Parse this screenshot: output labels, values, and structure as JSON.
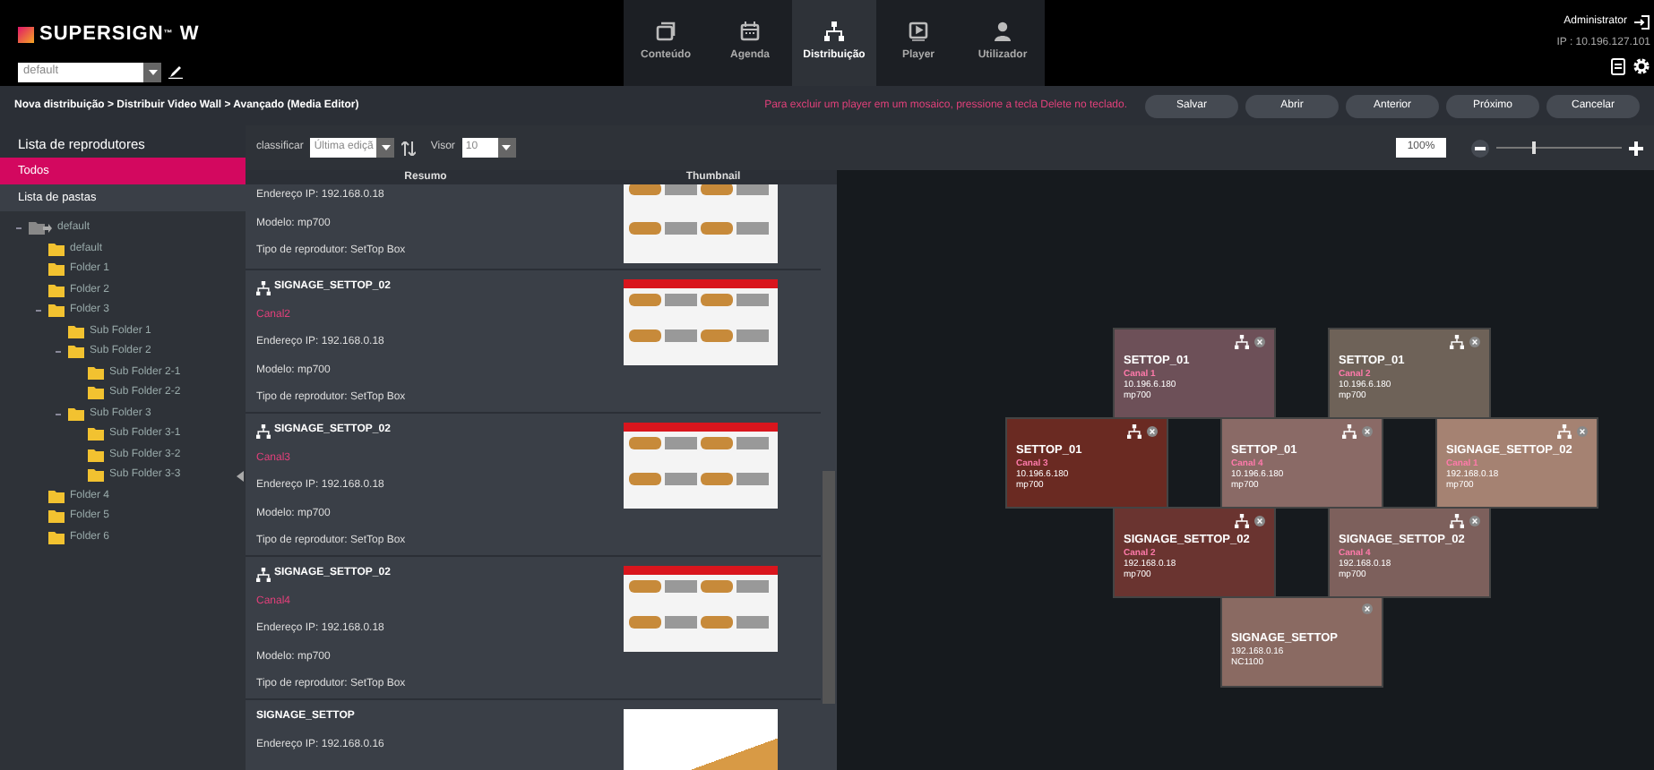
{
  "header": {
    "logo": "SUPERSIGN$^{™}$ W",
    "group_select": {
      "value": "default"
    },
    "tabs": [
      {
        "label": "Conteúdo",
        "kind": "content",
        "selected": false
      },
      {
        "label": "Agenda",
        "kind": "schedule",
        "selected": false
      },
      {
        "label": "Distribuição",
        "kind": "distribution",
        "selected": true
      },
      {
        "label": "Player",
        "kind": "player",
        "selected": false
      },
      {
        "label": "Utilizador",
        "kind": "user",
        "selected": false
      }
    ],
    "user": "Administrator",
    "ip": "IP : 10.196.127.101"
  },
  "breadcrumb": "Nova distribuição > Distribuir Video Wall > Avançado (Media Editor)",
  "hint": "Para excluir um player em um mosaico, pressione a tecla Delete no teclado.",
  "buttons": [
    "Salvar",
    "Abrir",
    "Anterior",
    "Próximo",
    "Cancelar"
  ],
  "sidebar": {
    "title": "Lista de reprodutores",
    "items": [
      {
        "label": "Todos",
        "selected": true
      },
      {
        "label": "Lista de pastas",
        "selected": false
      }
    ],
    "tree": [
      {
        "label": "default",
        "kind": "root",
        "expanded": true,
        "children": [
          {
            "label": "default"
          },
          {
            "label": "Folder 1"
          },
          {
            "label": "Folder 2"
          },
          {
            "label": "Folder 3",
            "expanded": true,
            "children": [
              {
                "label": "Sub Folder 1"
              },
              {
                "label": "Sub Folder 2",
                "expanded": true,
                "children": [
                  {
                    "label": "Sub Folder 2-1"
                  },
                  {
                    "label": "Sub Folder 2-2"
                  }
                ]
              },
              {
                "label": "Sub Folder 3",
                "expanded": true,
                "children": [
                  {
                    "label": "Sub Folder 3-1"
                  },
                  {
                    "label": "Sub Folder 3-2"
                  },
                  {
                    "label": "Sub Folder 3-3"
                  }
                ]
              }
            ]
          },
          {
            "label": "Folder 4"
          },
          {
            "label": "Folder 5"
          },
          {
            "label": "Folder 6"
          }
        ]
      }
    ]
  },
  "list_toolbar": {
    "sort_label": "classificar",
    "sort_value": "Última ediçã",
    "view_label": "Visor",
    "view_value": "10"
  },
  "list": {
    "columns": [
      "Resumo",
      "Thumbnail"
    ],
    "rows": [
      {
        "kind": "partial",
        "ip": "Endereço IP: 192.168.0.18",
        "model": "Modelo: mp700",
        "type": "Tipo de reprodutor: SetTop Box"
      },
      {
        "kind": "channel",
        "name": "SIGNAGE_SETTOP_02",
        "channel": "Canal2",
        "ip": "Endereço IP: 192.168.0.18",
        "model": "Modelo: mp700",
        "type": "Tipo de reprodutor: SetTop Box"
      },
      {
        "kind": "channel",
        "name": "SIGNAGE_SETTOP_02",
        "channel": "Canal3",
        "ip": "Endereço IP: 192.168.0.18",
        "model": "Modelo: mp700",
        "type": "Tipo de reprodutor: SetTop Box"
      },
      {
        "kind": "channel",
        "name": "SIGNAGE_SETTOP_02",
        "channel": "Canal4",
        "ip": "Endereço IP: 192.168.0.18",
        "model": "Modelo: mp700",
        "type": "Tipo de reprodutor: SetTop Box"
      },
      {
        "kind": "single",
        "name": "SIGNAGE_SETTOP",
        "ip": "Endereço IP: 192.168.0.16"
      }
    ]
  },
  "zoom": {
    "value": "100%",
    "level": 0.29
  },
  "mosaic": [
    {
      "kind": "channel",
      "name": "SETTOP_01",
      "channel": "Canal 1",
      "ip": "10.196.6.180",
      "model": "mp700"
    },
    {
      "kind": "channel",
      "name": "SETTOP_01",
      "channel": "Canal 2",
      "ip": "10.196.6.180",
      "model": "mp700"
    },
    {
      "kind": "channel",
      "name": "SETTOP_01",
      "channel": "Canal 3",
      "ip": "10.196.6.180",
      "model": "mp700"
    },
    {
      "kind": "channel",
      "name": "SETTOP_01",
      "channel": "Canal 4",
      "ip": "10.196.6.180",
      "model": "mp700"
    },
    {
      "kind": "channel",
      "name": "SIGNAGE_SETTOP_02",
      "channel": "Canal 1",
      "ip": "192.168.0.18",
      "model": "mp700"
    },
    {
      "kind": "channel",
      "name": "SIGNAGE_SETTOP_02",
      "channel": "Canal 2",
      "ip": "192.168.0.18",
      "model": "mp700"
    },
    {
      "kind": "channel",
      "name": "SIGNAGE_SETTOP_02",
      "channel": "Canal 4",
      "ip": "192.168.0.18",
      "model": "mp700"
    },
    {
      "kind": "single",
      "name": "SIGNAGE_SETTOP",
      "ip": "192.168.0.16",
      "model": "NC1100"
    }
  ]
}
